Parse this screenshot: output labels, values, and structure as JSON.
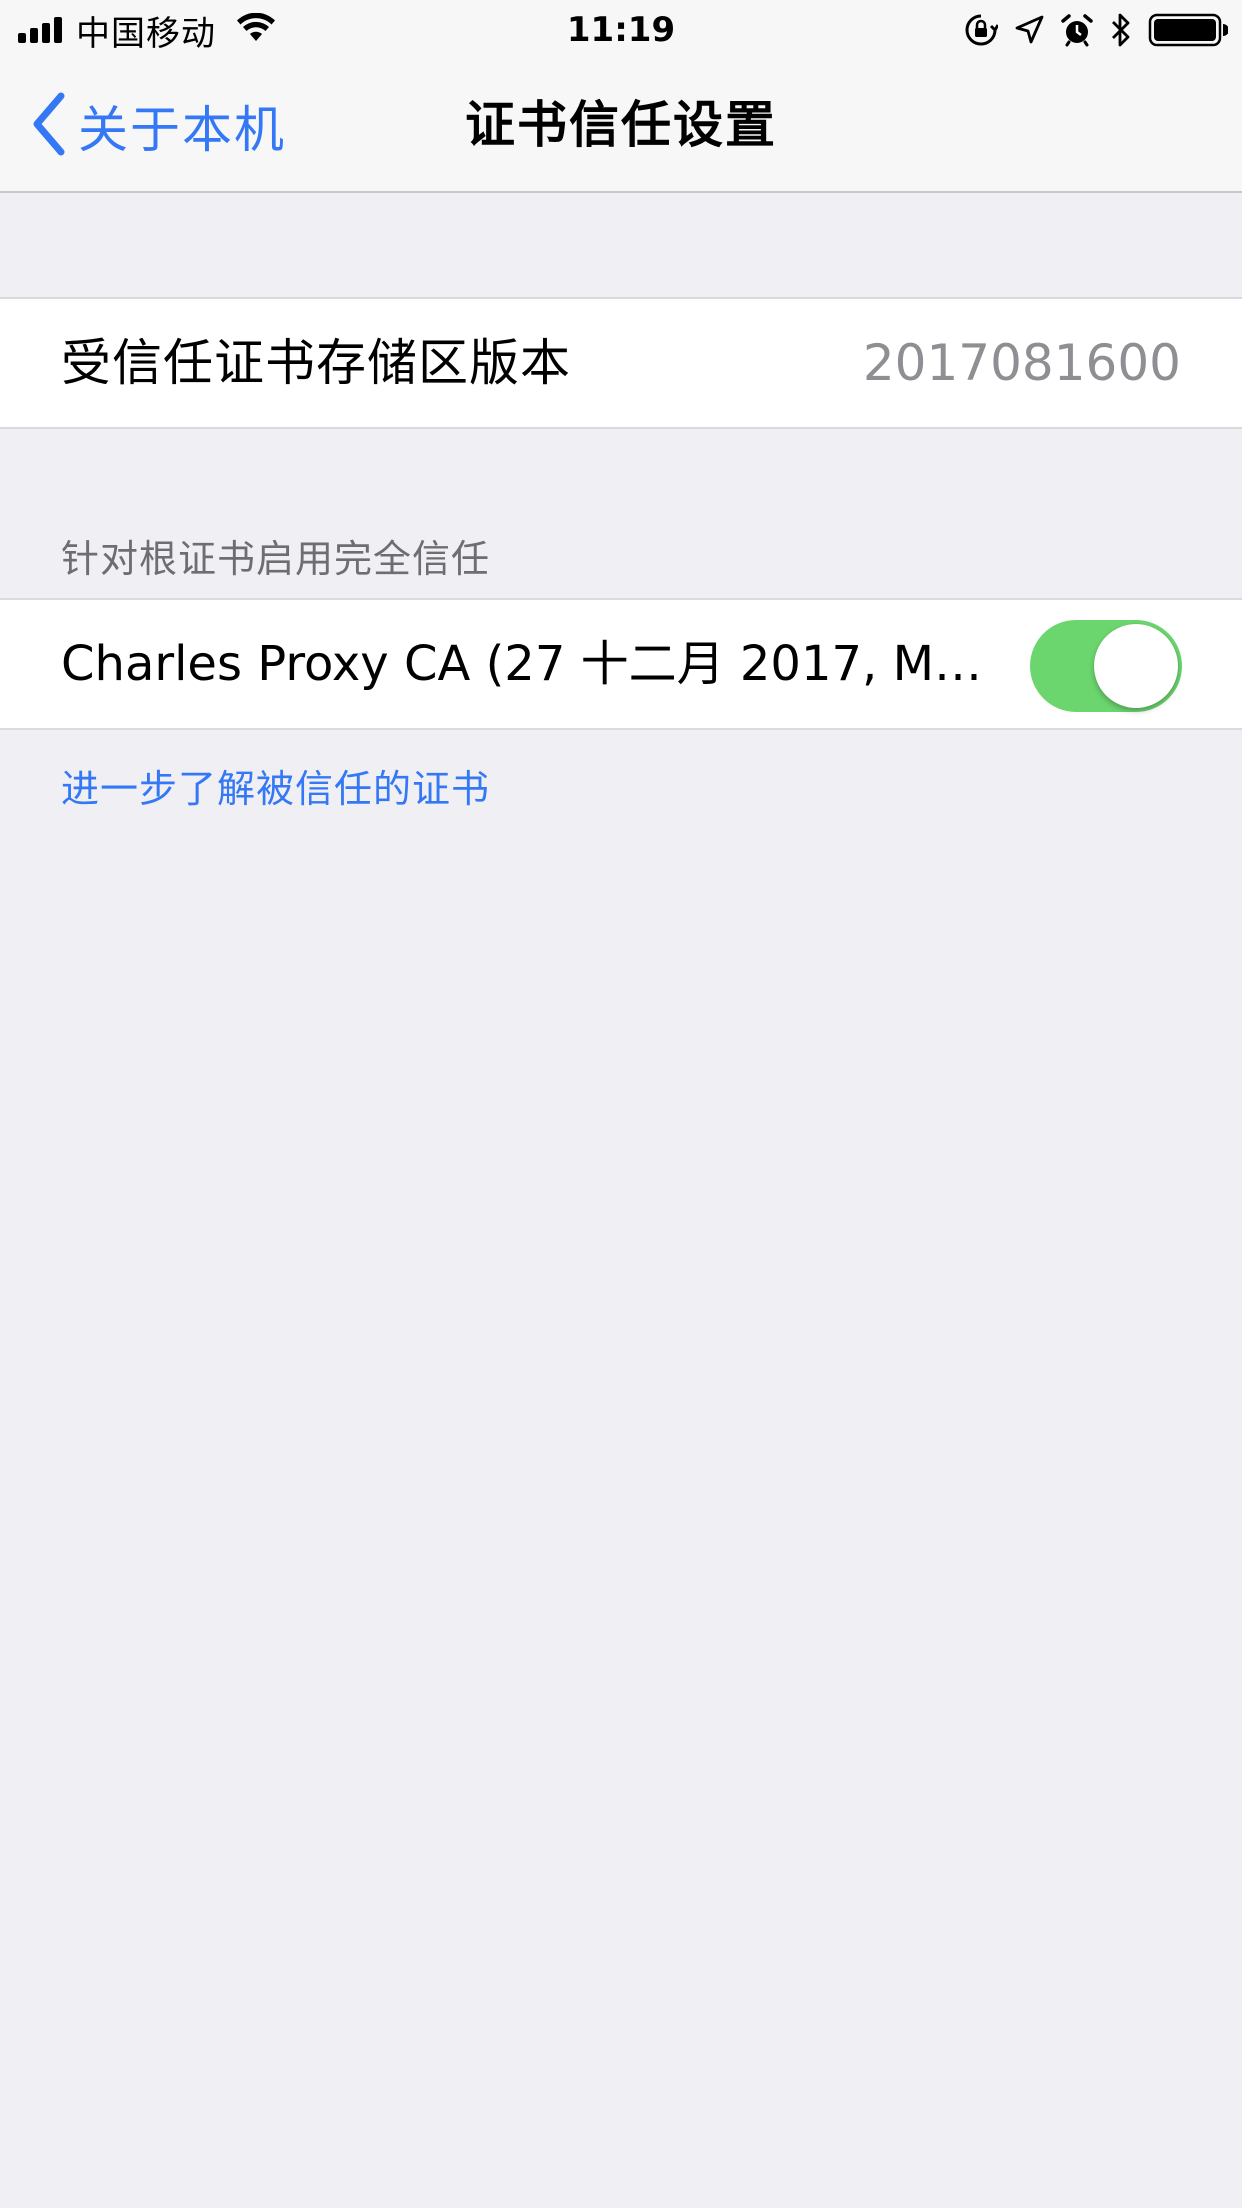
{
  "status_bar": {
    "carrier": "中国移动",
    "time": "11:19",
    "icons": [
      "signal-icon",
      "wifi-icon",
      "orientation-lock-icon",
      "location-icon",
      "alarm-icon",
      "bluetooth-icon",
      "battery-icon"
    ]
  },
  "nav": {
    "back_label": "关于本机",
    "title": "证书信任设置",
    "accent_color": "#3478f6"
  },
  "trust_store": {
    "label": "受信任证书存储区版本",
    "value": "2017081600"
  },
  "root_trust_section": {
    "header": "针对根证书启用完全信任",
    "certificates": [
      {
        "name": "Charles Proxy CA (27 十二月 2017, Mac…",
        "enabled": true
      }
    ],
    "toggle_on_color": "#6bd66e"
  },
  "footer": {
    "learn_more": "进一步了解被信任的证书"
  }
}
